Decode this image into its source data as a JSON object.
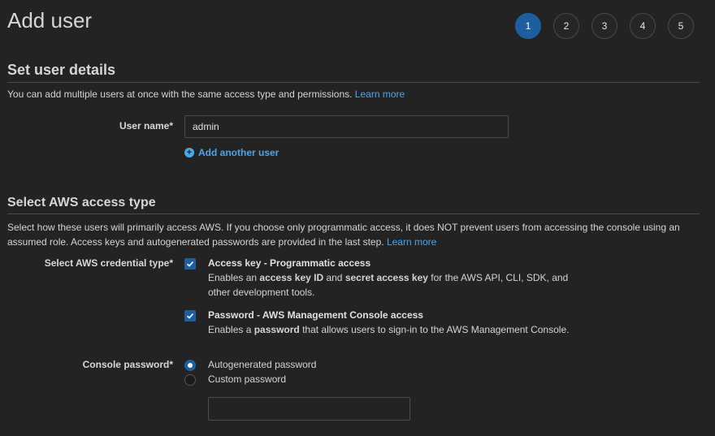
{
  "page": {
    "title": "Add user"
  },
  "steps": [
    "1",
    "2",
    "3",
    "4",
    "5"
  ],
  "active_step": "1",
  "details": {
    "title": "Set user details",
    "description": "You can add multiple users at once with the same access type and permissions.",
    "learn_more": "Learn more",
    "user_name_label": "User name*",
    "user_name_value": "admin",
    "add_another": "Add another user"
  },
  "access": {
    "title": "Select AWS access type",
    "description": "Select how these users will primarily access AWS. If you choose only programmatic access, it does NOT prevent users from accessing the console using an assumed role. Access keys and autogenerated passwords are provided in the last step.",
    "learn_more": "Learn more",
    "credential_label": "Select AWS credential type*",
    "options": [
      {
        "title": "Access key - Programmatic access",
        "checked": true,
        "desc_parts": [
          "Enables an ",
          "access key ID",
          " and ",
          "secret access key",
          " for the AWS API, CLI, SDK, and",
          "other development tools."
        ]
      },
      {
        "title": "Password - AWS Management Console access",
        "checked": true,
        "desc_parts": [
          "Enables a ",
          "password",
          " that allows users to sign-in to the AWS Management Console."
        ]
      }
    ],
    "console_password_label": "Console password*",
    "password_options": [
      {
        "label": "Autogenerated password",
        "selected": true
      },
      {
        "label": "Custom password",
        "selected": false
      }
    ],
    "custom_password_value": ""
  },
  "colors": {
    "background": "#232323",
    "accent": "#1d5e9e",
    "link": "#4ea5e8"
  }
}
